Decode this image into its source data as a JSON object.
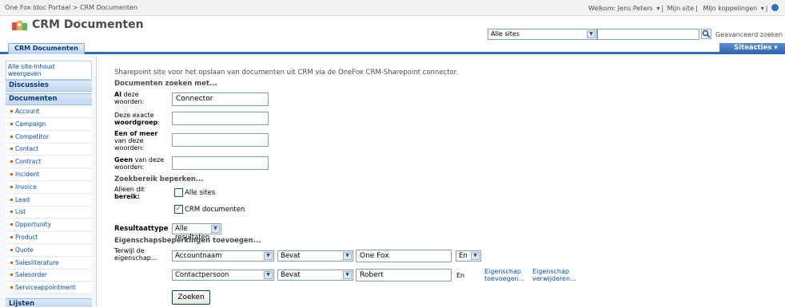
{
  "breadcrumb": "One Fox Idoc Portaal > CRM Documenten",
  "top_links": {
    "welcome": "Welkom: Jens Peters",
    "my_site": "Mijn site",
    "my_links": "Mijn koppelingen"
  },
  "site_title": "CRM Documenten",
  "search": {
    "scope": "Alle sites",
    "advanced": "Geavanceerd zoeken"
  },
  "tab": "CRM Documenten",
  "site_actions": "Siteacties",
  "sidebar": {
    "view_all": "Alle site-inhoud weergeven",
    "discussions": "Discussies",
    "documents": "Documenten",
    "items": [
      "Account",
      "Campaign",
      "Competitor",
      "Contact",
      "Contract",
      "Incident",
      "Invoice",
      "Lead",
      "List",
      "Opportunity",
      "Product",
      "Quote",
      "Salesliterature",
      "Salesorder",
      "Serviceappointment"
    ],
    "lists": "Lijsten"
  },
  "main": {
    "intro": "Sharepoint site voor het opslaan van documenten uit CRM via de OneFox CRM-Sharepoint connector.",
    "find_header": "Documenten zoeken met...",
    "all_words_bold": "Al",
    "all_words_rest": " deze woorden:",
    "all_words_value": "Connector",
    "exact_phrase_pre": "Deze exacte ",
    "exact_phrase_bold": "woordgroep",
    "exact_phrase_post": ":",
    "any_words_bold": "Een of meer",
    "any_words_rest": " van deze woorden:",
    "none_words_bold": "Geen",
    "none_words_rest": " van deze woorden:",
    "narrow_header": "Zoekbereik beperken...",
    "scope_label_pre": "Alleen dit ",
    "scope_label_bold": "bereik",
    "scope_label_post": ":",
    "scope_all_sites": "Alle sites",
    "scope_crm_docs": "CRM documenten",
    "result_type_label": "Resultaattype",
    "result_type_value": "Alle resultaten",
    "property_header": "Eigenschapsbeperkingen toevoegen...",
    "where_property": "Terwijl de eigenschap...",
    "row1": {
      "property": "Accountnaam",
      "operator": "Bevat",
      "value": "One Fox",
      "joiner": "En"
    },
    "row2": {
      "property": "Contactpersoon",
      "operator": "Bevat",
      "value": "Robert",
      "joiner": "En"
    },
    "add_property": "Eigenschap toevoegen...",
    "remove_property": "Eigenschap verwijderen...",
    "search_button": "Zoeken"
  }
}
